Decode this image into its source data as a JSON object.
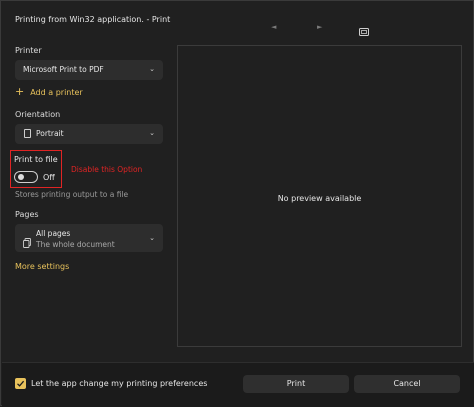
{
  "window": {
    "title": "Printing from Win32 application. - Print"
  },
  "icons": {
    "nav_prev": "◄",
    "nav_next": "►",
    "fit_page": "fit-page-icon",
    "chevron": "⌄",
    "plus": "+"
  },
  "printer": {
    "label": "Printer",
    "selected": "Microsoft Print to PDF",
    "add_label": "Add a printer"
  },
  "orientation": {
    "label": "Orientation",
    "selected": "Portrait"
  },
  "print_to_file": {
    "label": "Print to file",
    "state": "Off",
    "description": "Stores printing output to a file",
    "annotation": "Disable this Option"
  },
  "pages": {
    "label": "Pages",
    "selected_title": "All pages",
    "selected_subtitle": "The whole document"
  },
  "more_settings": "More settings",
  "preview": {
    "message": "No preview available"
  },
  "footer": {
    "checkbox_label": "Let the app change my printing preferences",
    "checkbox_checked": true,
    "print_button": "Print",
    "cancel_button": "Cancel"
  },
  "colors": {
    "accent": "#e8c25c",
    "annotation": "#e02424",
    "background": "#202020"
  }
}
